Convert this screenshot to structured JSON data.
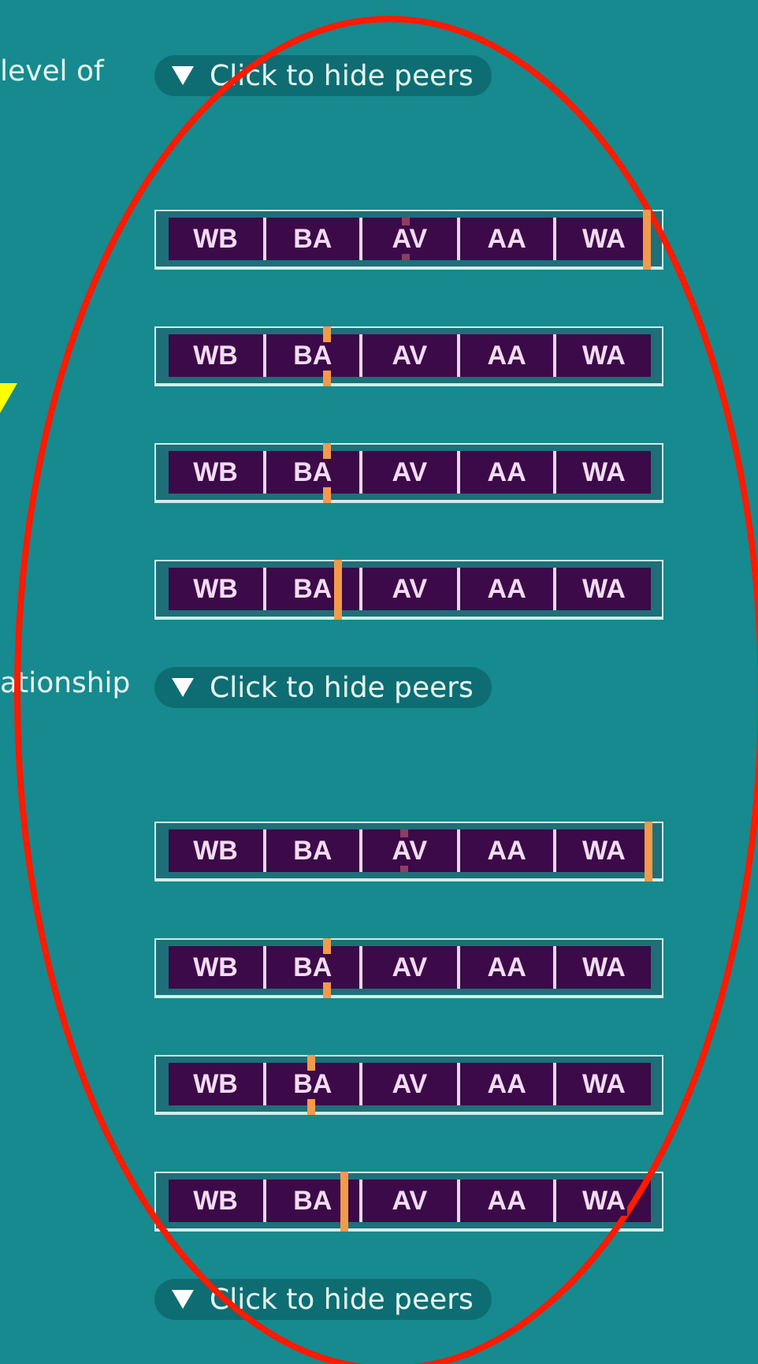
{
  "sections": [
    {
      "side_text": "level of",
      "toggle": {
        "label": "Click to hide peers",
        "expanded": true
      },
      "scales": [
        {
          "segments": [
            "WB",
            "BA",
            "AV",
            "AA",
            "WA"
          ],
          "markers": [
            {
              "kind": "peer",
              "level": 0.493
            },
            {
              "kind": "self",
              "level": 0.993
            }
          ]
        },
        {
          "segments": [
            "WB",
            "BA",
            "AV",
            "AA",
            "WA"
          ],
          "markers": [
            {
              "kind": "self",
              "level": 0.33
            }
          ]
        },
        {
          "segments": [
            "WB",
            "BA",
            "AV",
            "AA",
            "WA"
          ],
          "markers": [
            {
              "kind": "self",
              "level": 0.33
            }
          ]
        },
        {
          "segments": [
            "WB",
            "BA",
            "AV",
            "AA",
            "WA"
          ],
          "markers": [
            {
              "kind": "self",
              "level": 0.353
            }
          ]
        }
      ]
    },
    {
      "side_text": "ationship",
      "toggle": {
        "label": "Click to hide peers",
        "expanded": true
      },
      "scales": [
        {
          "segments": [
            "WB",
            "BA",
            "AV",
            "AA",
            "WA"
          ],
          "markers": [
            {
              "kind": "peer",
              "level": 0.49
            },
            {
              "kind": "self",
              "level": 0.996
            }
          ]
        },
        {
          "segments": [
            "WB",
            "BA",
            "AV",
            "AA",
            "WA"
          ],
          "markers": [
            {
              "kind": "self",
              "level": 0.33
            }
          ]
        },
        {
          "segments": [
            "WB",
            "BA",
            "AV",
            "AA",
            "WA"
          ],
          "markers": [
            {
              "kind": "self",
              "level": 0.297
            }
          ]
        },
        {
          "segments": [
            "WB",
            "BA",
            "AV",
            "AA",
            "WA"
          ],
          "markers": [
            {
              "kind": "self",
              "level": 0.366
            }
          ]
        }
      ]
    },
    {
      "toggle": {
        "label": "Click to hide peers",
        "expanded": true
      }
    }
  ]
}
